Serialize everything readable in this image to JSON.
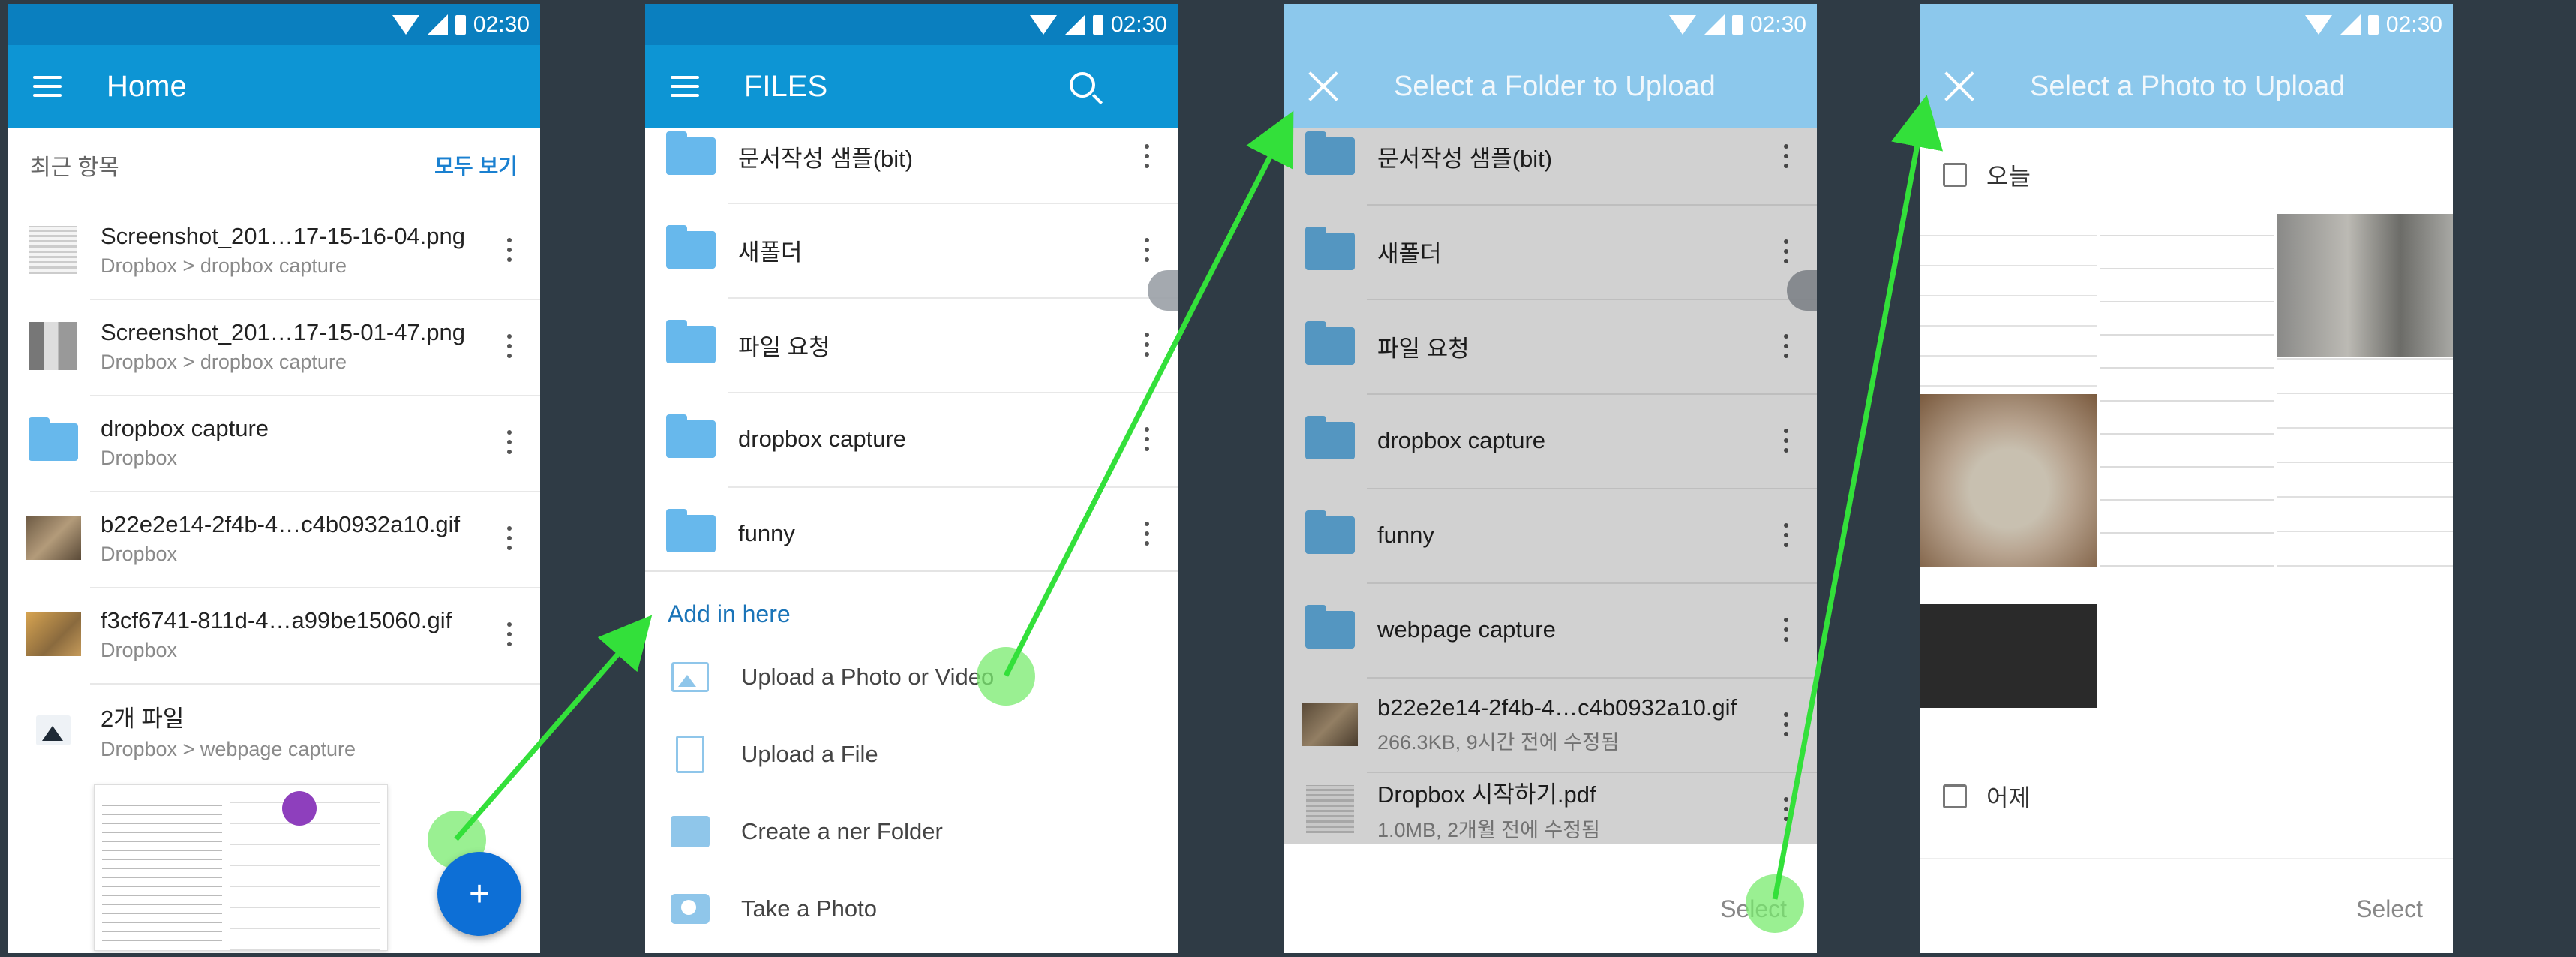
{
  "status": {
    "time": "02:30"
  },
  "screen1": {
    "title": "Home",
    "section_title": "최근 항목",
    "section_link": "모두 보기",
    "items": [
      {
        "name": "Screenshot_201…17-15-16-04.png",
        "sub": "Dropbox > dropbox capture",
        "icon": "screenshot-thumb"
      },
      {
        "name": "Screenshot_201…17-15-01-47.png",
        "sub": "Dropbox > dropbox capture",
        "icon": "screenshot-thumb"
      },
      {
        "name": "dropbox capture",
        "sub": "Dropbox",
        "icon": "folder-icon"
      },
      {
        "name": "b22e2e14-2f4b-4…c4b0932a10.gif",
        "sub": "Dropbox",
        "icon": "cat-thumb"
      },
      {
        "name": "f3cf6741-811d-4…a99be15060.gif",
        "sub": "Dropbox",
        "icon": "dog-thumb"
      },
      {
        "name": "2개 파일",
        "sub": "Dropbox > webpage capture",
        "icon": "image-icon"
      }
    ],
    "fab_label": "+"
  },
  "screen2": {
    "title": "FILES",
    "folders": [
      "문서작성 샘플(bit)",
      "새폴더",
      "파일 요청",
      "dropbox capture",
      "funny"
    ],
    "add_title": "Add in here",
    "actions": [
      {
        "label": "Upload a Photo or Video",
        "icon": "photo-icon"
      },
      {
        "label": "Upload a File",
        "icon": "file-icon"
      },
      {
        "label": "Create a ner Folder",
        "icon": "folder-icon"
      },
      {
        "label": "Take a Photo",
        "icon": "camera-icon"
      }
    ]
  },
  "screen3": {
    "title": "Select a Folder to Upload",
    "folders": [
      "문서작성 샘플(bit)",
      "새폴더",
      "파일 요청",
      "dropbox capture",
      "funny",
      "webpage capture"
    ],
    "files": [
      {
        "name": "b22e2e14-2f4b-4…c4b0932a10.gif",
        "sub": "266.3KB, 9시간 전에 수정됨"
      },
      {
        "name": "Dropbox 시작하기.pdf",
        "sub": "1.0MB, 2개월 전에 수정됨"
      }
    ],
    "select_label": "Select"
  },
  "screen4": {
    "title": "Select a Photo to Upload",
    "group_today": "오늘",
    "group_yesterday": "어제",
    "select_label": "Select"
  },
  "colors": {
    "appbar": "#0d95d4",
    "appbar_dim": "#8cc8ec",
    "fab": "#0d6fd6",
    "arrow": "#33e03a"
  }
}
